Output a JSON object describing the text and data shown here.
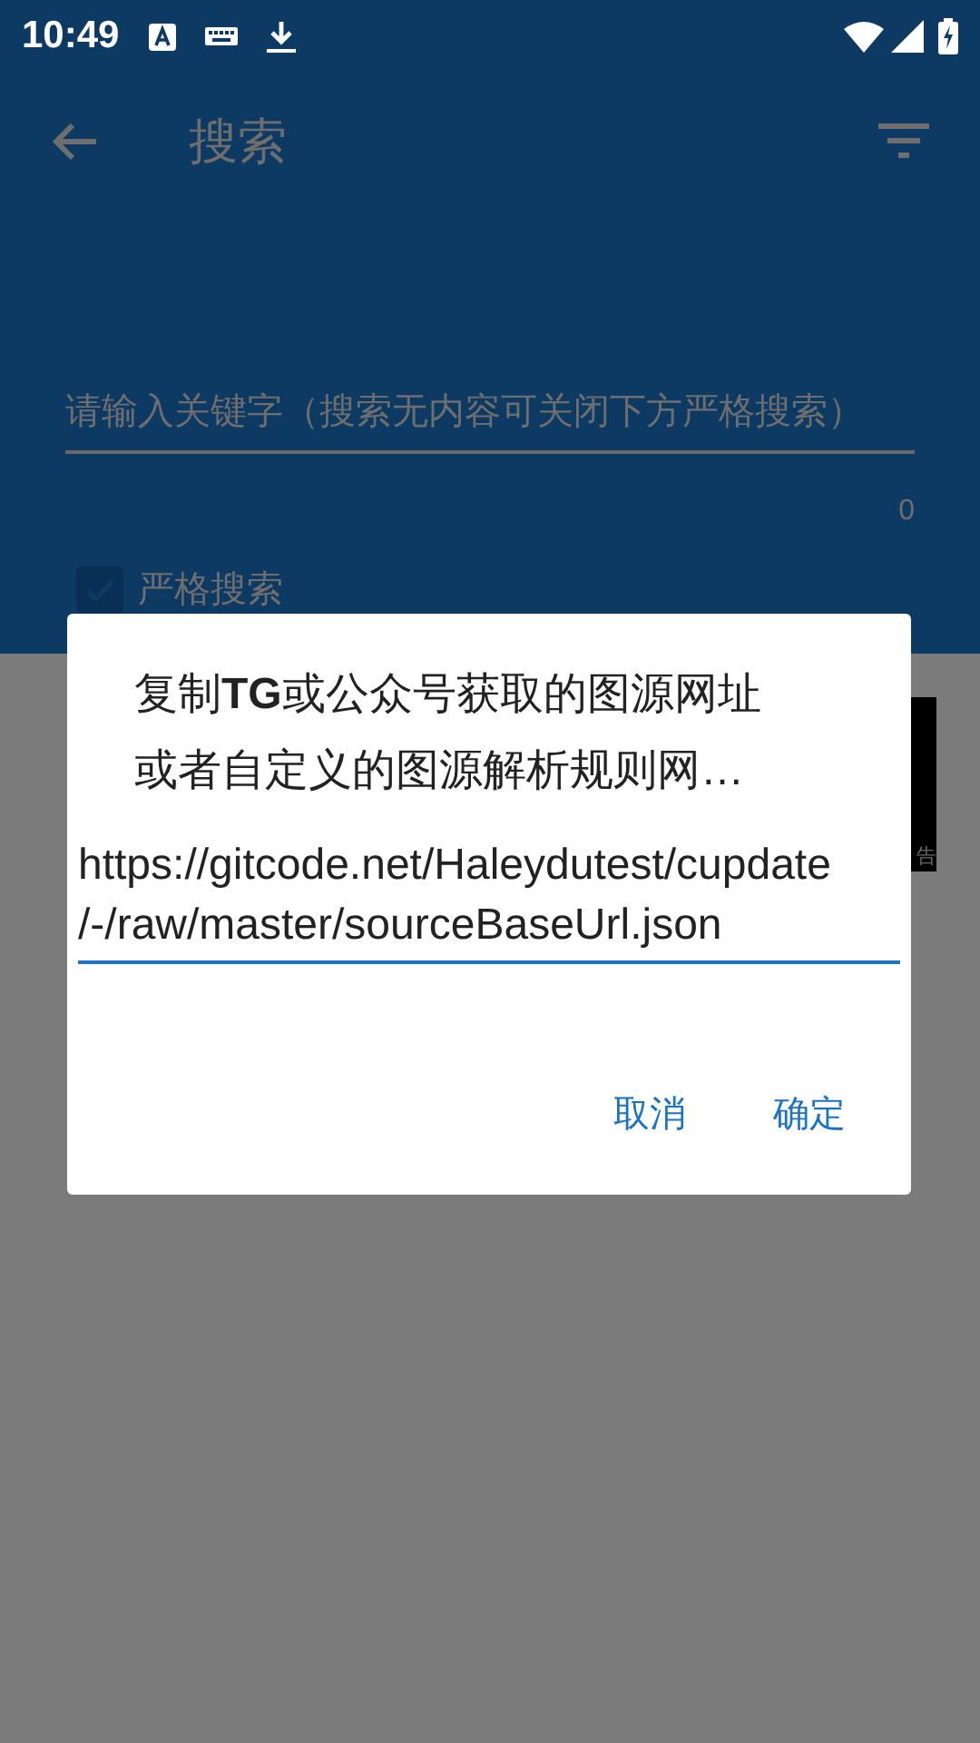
{
  "status_bar": {
    "time": "10:49"
  },
  "toolbar": {
    "title": "搜索"
  },
  "search": {
    "placeholder": "请输入关键字（搜索无内容可关闭下方严格搜索）",
    "counter": "0"
  },
  "strict_search": {
    "label": "严格搜索",
    "checked": true
  },
  "ad": {
    "text": "告"
  },
  "dialog": {
    "title": "复制**TG**或公众号获取的图源网址或者自定义的图源解析规则网…",
    "value": "https://gitcode.net/Haleydutest/cupdate/-/raw/master/sourceBaseUrl.json",
    "buttons": [
      {
        "label": "取消"
      },
      {
        "label": "确定"
      }
    ]
  }
}
